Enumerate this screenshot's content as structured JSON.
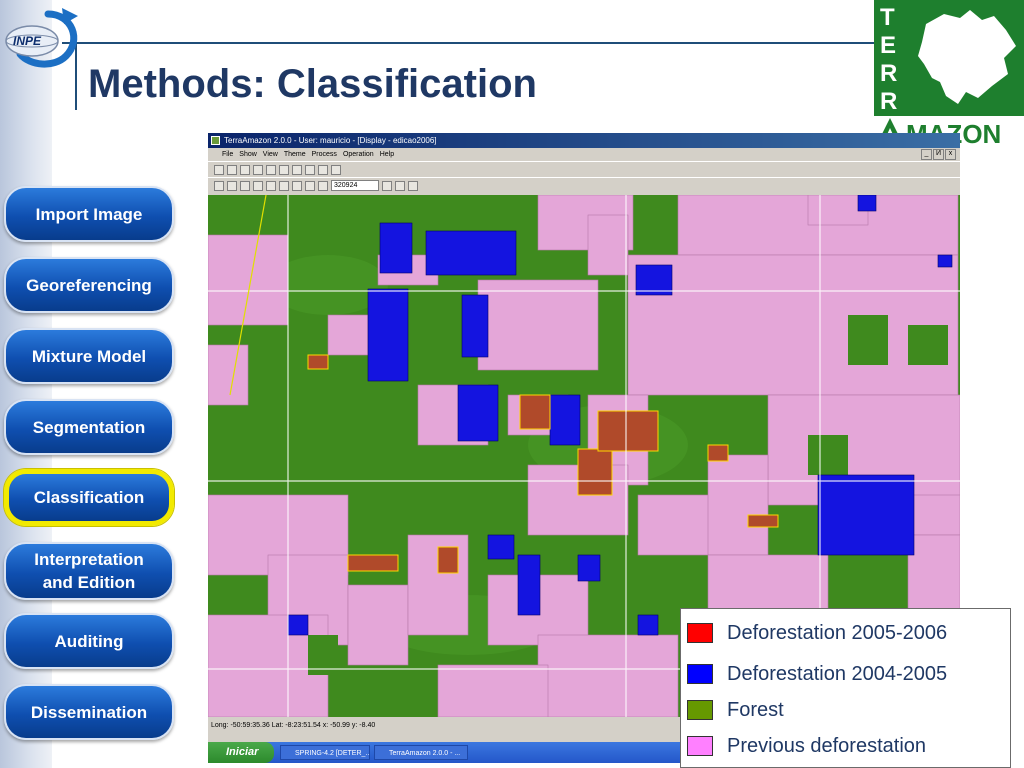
{
  "slide": {
    "title": "Methods: Classification"
  },
  "logos": {
    "inpe": "INPE",
    "terra_letters": [
      "T",
      "E",
      "R",
      "R"
    ],
    "amazon": "MAZON"
  },
  "nav": {
    "items": [
      {
        "label": "Import Image"
      },
      {
        "label": "Georeferencing"
      },
      {
        "label": "Mixture Model"
      },
      {
        "label": "Segmentation"
      },
      {
        "label": "Classification",
        "active": true
      },
      {
        "label": "Interpretation and Edition"
      },
      {
        "label": "Auditing"
      },
      {
        "label": "Dissemination"
      }
    ]
  },
  "app": {
    "title": "TerraAmazon 2.0.0 - User: mauricio - [Display - edicao2006]",
    "menu": [
      "File",
      "Show",
      "View",
      "Theme",
      "Process",
      "Operation",
      "Help"
    ],
    "window_controls": [
      "_",
      "И",
      "x"
    ],
    "scale": "320924",
    "status": "Long: -50:59:35.36  Lat: -8:23:51.54  x: -50.99  y: -8.40",
    "taskbar": {
      "start": "Iniciar",
      "tasks": [
        "SPRING-4.2 [DETER_...",
        "TerraAmazon 2.0.0 - ..."
      ]
    }
  },
  "legend": {
    "items": [
      {
        "label": "Deforestation 2005-2006",
        "color": "#ff0000"
      },
      {
        "label": "Deforestation 2004-2005",
        "color": "#0000ff"
      },
      {
        "label": "Forest",
        "color": "#669900"
      },
      {
        "label": "Previous deforestation",
        "color": "#ff80ff"
      }
    ]
  },
  "colors": {
    "title": "#1f3864",
    "nav_blue": "#0f4fb0",
    "active_outline": "#f2ea00",
    "forest": "#3f8a1e",
    "previous_deforestation": "#e4a6d8",
    "def_2004_2005": "#1414e0",
    "def_2005_2006": "#b04a2a"
  }
}
